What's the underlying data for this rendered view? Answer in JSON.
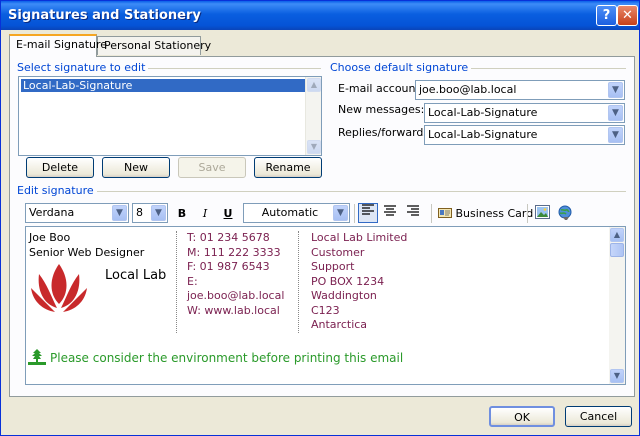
{
  "window": {
    "title": "Signatures and Stationery",
    "help": "?",
    "close": "✕"
  },
  "tabs": [
    {
      "label": "E-mail Signature"
    },
    {
      "label": "Personal Stationery"
    }
  ],
  "select_section": {
    "label": "Select signature to edit",
    "items": [
      "Local-Lab-Signature"
    ],
    "selected": "Local-Lab-Signature",
    "buttons": {
      "delete": "Delete",
      "new": "New",
      "save": "Save",
      "rename": "Rename"
    }
  },
  "default_section": {
    "label": "Choose default signature",
    "email_account_label": "E-mail account:",
    "email_account_value": "joe.boo@lab.local",
    "new_messages_label": "New messages:",
    "new_messages_value": "Local-Lab-Signature",
    "replies_label": "Replies/forwards:",
    "replies_value": "Local-Lab-Signature"
  },
  "edit_section": {
    "label": "Edit signature",
    "toolbar": {
      "font": "Verdana",
      "size": "8",
      "bold": "B",
      "italic": "I",
      "underline": "U",
      "color": "Automatic",
      "business_card": "Business Card"
    },
    "signature": {
      "name": "Joe Boo",
      "job_title": "Senior Web Designer",
      "logo_text": "Local Lab",
      "contact_lines": [
        "T: 01 234 5678",
        "M: 111 222 3333",
        "F: 01 987 6543",
        "E:",
        "joe.boo@lab.local",
        "W: www.lab.local"
      ],
      "address_lines": [
        "Local Lab Limited",
        "Customer",
        "Support",
        "PO BOX 1234",
        "Waddington",
        "C123",
        "Antarctica"
      ],
      "environment_note": "Please consider the environment before printing this email"
    }
  },
  "footer": {
    "ok": "OK",
    "cancel": "Cancel"
  },
  "colors": {
    "accent": "#0046d5",
    "logo_red": "#c8292b",
    "maroon": "#7a1f4f",
    "green": "#2a9a2a"
  }
}
